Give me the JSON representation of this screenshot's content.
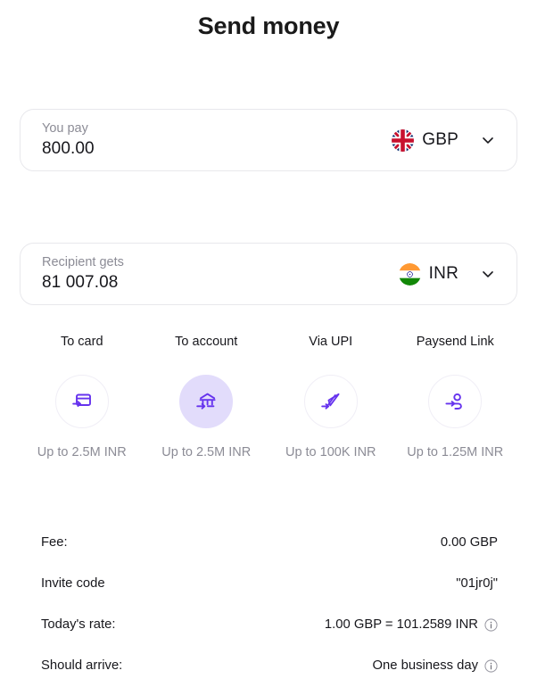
{
  "header": {
    "title": "Send money"
  },
  "send_form": {
    "pay": {
      "label": "You pay",
      "value": "800.00",
      "currency": "GBP",
      "flag": "uk-flag-icon",
      "chevron": "chevron-down-icon"
    },
    "receive": {
      "label": "Recipient gets",
      "value": "81 007.08",
      "currency": "INR",
      "flag": "india-flag-icon",
      "chevron": "chevron-down-icon"
    }
  },
  "delivery_methods": {
    "selected": "To account",
    "items": [
      {
        "label": "To card",
        "limit": "Up to 2.5M INR",
        "icon": "card-icon",
        "selected": false
      },
      {
        "label": "To account",
        "limit": "Up to 2.5M INR",
        "icon": "bank-icon",
        "selected": true
      },
      {
        "label": "Via UPI",
        "limit": "Up to 100K INR",
        "icon": "upi-icon",
        "selected": false
      },
      {
        "label": "Paysend Link",
        "limit": "Up to 1.25M INR",
        "icon": "person-link-icon",
        "selected": false
      }
    ]
  },
  "details": {
    "rows": [
      {
        "key": "Fee:",
        "value": "0.00 GBP",
        "info": false
      },
      {
        "key": "Invite code",
        "value": "\"01jr0j\"",
        "info": false
      },
      {
        "key": "Today's rate:",
        "value": "1.00 GBP = 101.2589 INR",
        "info": true
      },
      {
        "key": "Should arrive:",
        "value": "One business day",
        "info": true
      }
    ]
  },
  "colors": {
    "accent_purple": "#6633ee",
    "selected_bg": "#e2dcfb",
    "text_primary": "#17171c",
    "text_muted": "#8c8c96",
    "border": "#e8e8ec"
  }
}
